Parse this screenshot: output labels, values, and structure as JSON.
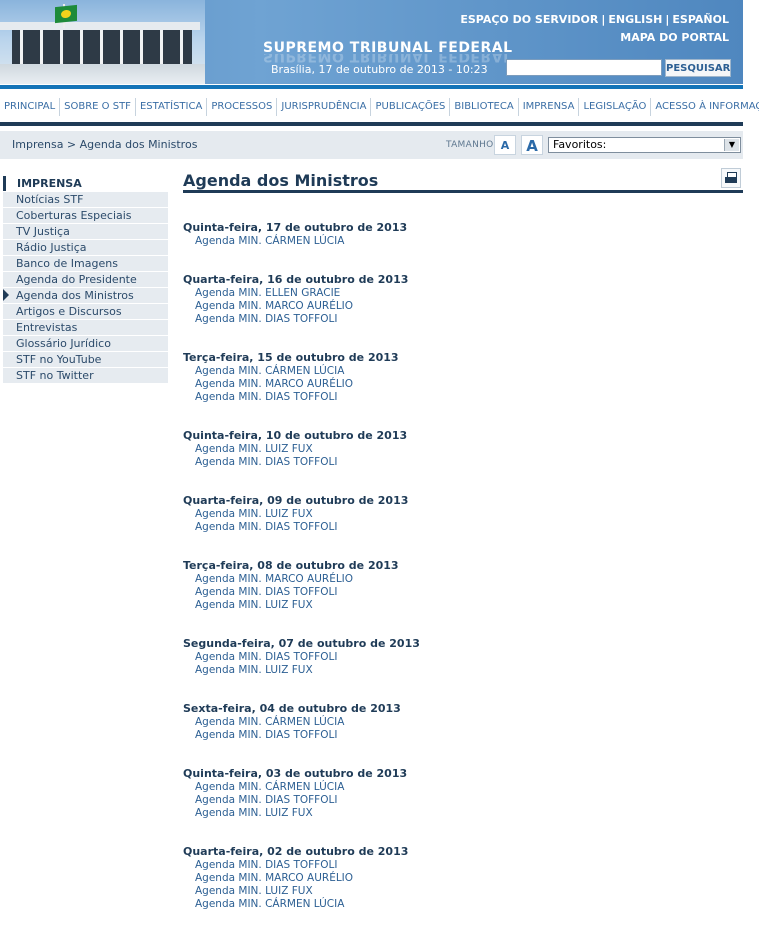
{
  "header": {
    "site_title": "SUPREMO TRIBUNAL FEDERAL",
    "date": "Brasília, 17 de outubro de 2013 - 10:23",
    "links": [
      "ESPAÇO DO SERVIDOR",
      "ENGLISH",
      "ESPAÑOL"
    ],
    "mapa": "MAPA DO PORTAL",
    "search_value": "",
    "search_button": "PESQUISAR",
    "colors": {
      "header_bg": "#5a8fc4",
      "nav_line": "#1474b8",
      "dark_navy": "#1f3b57"
    }
  },
  "nav": [
    "PRINCIPAL",
    "SOBRE O STF",
    "ESTATÍSTICA",
    "PROCESSOS",
    "JURISPRUDÊNCIA",
    "PUBLICAÇÕES",
    "BIBLIOTECA",
    "IMPRENSA",
    "LEGISLAÇÃO",
    "ACESSO À INFORMAÇÃO"
  ],
  "breadcrumb": {
    "root": "Imprensa",
    "separator": " > ",
    "current": "Agenda dos Ministros"
  },
  "font_size": {
    "label": "TAMANHO",
    "small": "A",
    "large": "A"
  },
  "favoritos": {
    "selected": "Favoritos:"
  },
  "sidebar": {
    "title": "IMPRENSA",
    "items": [
      "Notícias STF",
      "Coberturas Especiais",
      "TV Justiça",
      "Rádio Justiça",
      "Banco de Imagens",
      "Agenda do Presidente",
      "Agenda dos Ministros",
      "Artigos e Discursos",
      "Entrevistas",
      "Glossário Jurídico",
      "STF no YouTube",
      "STF no Twitter"
    ],
    "active_index": 6
  },
  "main": {
    "title": "Agenda dos Ministros",
    "print_icon": "printer-icon",
    "days": [
      {
        "heading": "Quinta-feira, 17 de outubro de 2013",
        "links": [
          "Agenda MIN. CÁRMEN LÚCIA"
        ]
      },
      {
        "heading": "Quarta-feira, 16 de outubro de 2013",
        "links": [
          "Agenda MIN. ELLEN GRACIE",
          "Agenda MIN. MARCO AURÉLIO",
          "Agenda MIN. DIAS TOFFOLI"
        ]
      },
      {
        "heading": "Terça-feira, 15 de outubro de 2013",
        "links": [
          "Agenda MIN. CÁRMEN LÚCIA",
          "Agenda MIN. MARCO AURÉLIO",
          "Agenda MIN. DIAS TOFFOLI"
        ]
      },
      {
        "heading": "Quinta-feira, 10 de outubro de 2013",
        "links": [
          "Agenda MIN. LUIZ FUX",
          "Agenda MIN. DIAS TOFFOLI"
        ]
      },
      {
        "heading": "Quarta-feira, 09 de outubro de 2013",
        "links": [
          "Agenda MIN. LUIZ FUX",
          "Agenda MIN. DIAS TOFFOLI"
        ]
      },
      {
        "heading": "Terça-feira, 08 de outubro de 2013",
        "links": [
          "Agenda MIN. MARCO AURÉLIO",
          "Agenda MIN. DIAS TOFFOLI",
          "Agenda MIN. LUIZ FUX"
        ]
      },
      {
        "heading": "Segunda-feira, 07 de outubro de 2013",
        "links": [
          "Agenda MIN. DIAS TOFFOLI",
          "Agenda MIN. LUIZ FUX"
        ]
      },
      {
        "heading": "Sexta-feira, 04 de outubro de 2013",
        "links": [
          "Agenda MIN. CÁRMEN LÚCIA",
          "Agenda MIN. DIAS TOFFOLI"
        ]
      },
      {
        "heading": "Quinta-feira, 03 de outubro de 2013",
        "links": [
          "Agenda MIN. CÁRMEN LÚCIA",
          "Agenda MIN. DIAS TOFFOLI",
          "Agenda MIN. LUIZ FUX"
        ]
      },
      {
        "heading": "Quarta-feira, 02 de outubro de 2013",
        "links": [
          "Agenda MIN. DIAS TOFFOLI",
          "Agenda MIN. MARCO AURÉLIO",
          "Agenda MIN. LUIZ FUX",
          "Agenda MIN. CÁRMEN LÚCIA"
        ]
      }
    ]
  }
}
